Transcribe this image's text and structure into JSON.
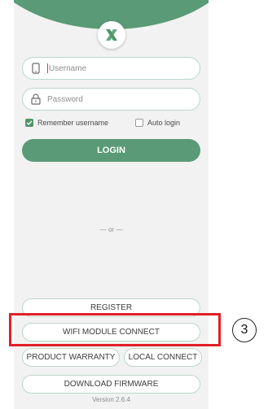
{
  "login": {
    "username_placeholder": "Username",
    "password_placeholder": "Password",
    "remember_label": "Remember username",
    "remember_checked": true,
    "auto_login_label": "Auto login",
    "auto_login_checked": false,
    "login_label": "LOGIN"
  },
  "divider": {
    "text": "— or —"
  },
  "actions": {
    "register": "REGISTER",
    "wifi_module_connect": "WIFI MODULE CONNECT",
    "product_warranty": "PRODUCT WARRANTY",
    "local_connect": "LOCAL CONNECT",
    "download_firmware": "DOWNLOAD FIRMWARE"
  },
  "version": "Version 2.6.4",
  "annotation": {
    "step": "3"
  },
  "icons": {
    "logo": "x-logo-icon",
    "phone": "phone-icon",
    "lock": "lock-icon",
    "check": "checkmark-icon"
  },
  "colors": {
    "brand_green": "#5a9a76",
    "highlight_red": "#e11f26"
  }
}
